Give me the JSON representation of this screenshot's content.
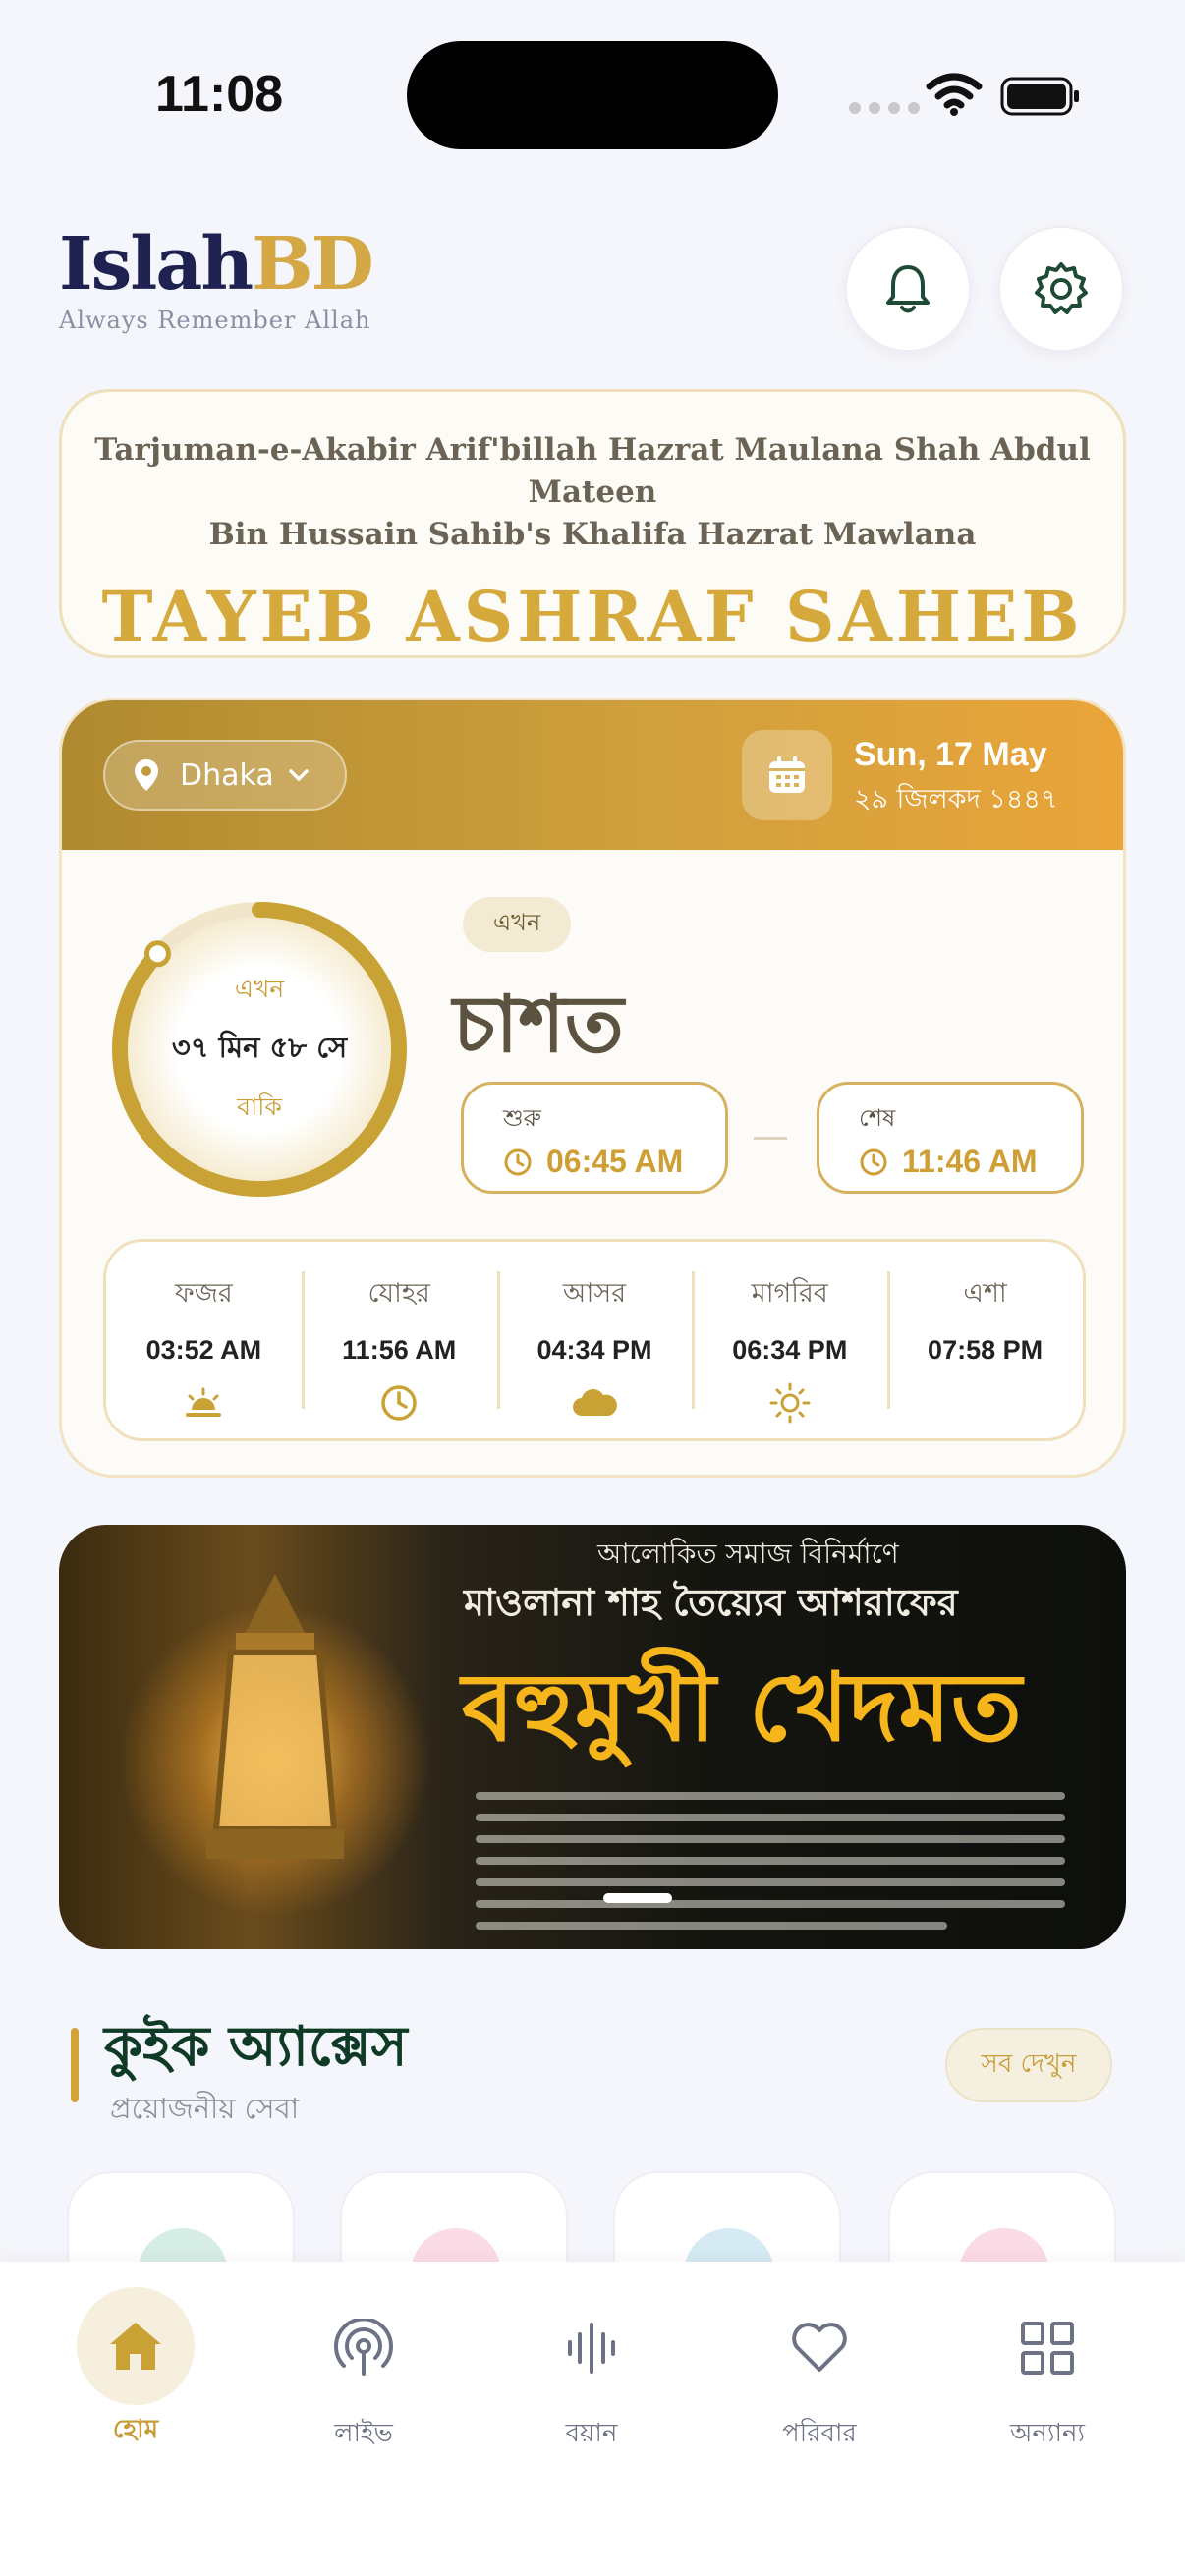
{
  "status": {
    "time": "11:08"
  },
  "header": {
    "logo_part1": "Islah",
    "logo_part2": "BD",
    "tagline": "Always Remember Allah",
    "icons": [
      "bell-icon",
      "gear-icon"
    ]
  },
  "title_card": {
    "subtitle_line1": "Tarjuman-e-Akabir Arif'billah Hazrat Maulana Shah Abdul Mateen",
    "subtitle_line2": "Bin Hussain Sahib's Khalifa Hazrat Mawlana",
    "name": "TAYEB ASHRAF SAHEB"
  },
  "prayer": {
    "location": "Dhaka",
    "date_en": "Sun, 17 May",
    "date_hijri": "২৯ জিলকদ ১৪৪৭",
    "ring": {
      "label_top": "এখন",
      "countdown": "৩৭ মিন ৫৮ সে",
      "label_bottom": "বাকি",
      "progress": 0.87
    },
    "now_badge": "এখন",
    "current_name": "চাশত",
    "start": {
      "label": "শুরু",
      "time": "06:45 AM"
    },
    "end": {
      "label": "শেষ",
      "time": "11:46 AM"
    },
    "times": [
      {
        "name": "ফজর",
        "time": "03:52 AM",
        "icon": "sunrise-icon"
      },
      {
        "name": "যোহর",
        "time": "11:56 AM",
        "icon": "clock-icon"
      },
      {
        "name": "আসর",
        "time": "04:34 PM",
        "icon": "cloud-icon"
      },
      {
        "name": "মাগরিব",
        "time": "06:34 PM",
        "icon": "sun-icon"
      },
      {
        "name": "এশা",
        "time": "07:58 PM",
        "icon": "moon-icon"
      }
    ]
  },
  "banner": {
    "line1": "আলোকিত সমাজ বিনির্মাণে",
    "line2": "মাওলানা শাহ তৈয়্যেব আশরাফের",
    "line3": "বহুমুখী খেদমত"
  },
  "quick_access": {
    "title": "কুইক অ্যাক্সেস",
    "subtitle": "প্রয়োজনীয় সেবা",
    "see_all": "সব দেখুন"
  },
  "nav": [
    {
      "label": "হোম",
      "icon": "home-icon",
      "active": true
    },
    {
      "label": "লাইভ",
      "icon": "broadcast-icon",
      "active": false
    },
    {
      "label": "বয়ান",
      "icon": "audio-wave-icon",
      "active": false
    },
    {
      "label": "পরিবার",
      "icon": "heart-icon",
      "active": false
    },
    {
      "label": "অন্যান্য",
      "icon": "grid-icon",
      "active": false
    }
  ],
  "colors": {
    "gold": "#d4a845",
    "navy": "#1f2150",
    "green": "#0f3b26"
  }
}
